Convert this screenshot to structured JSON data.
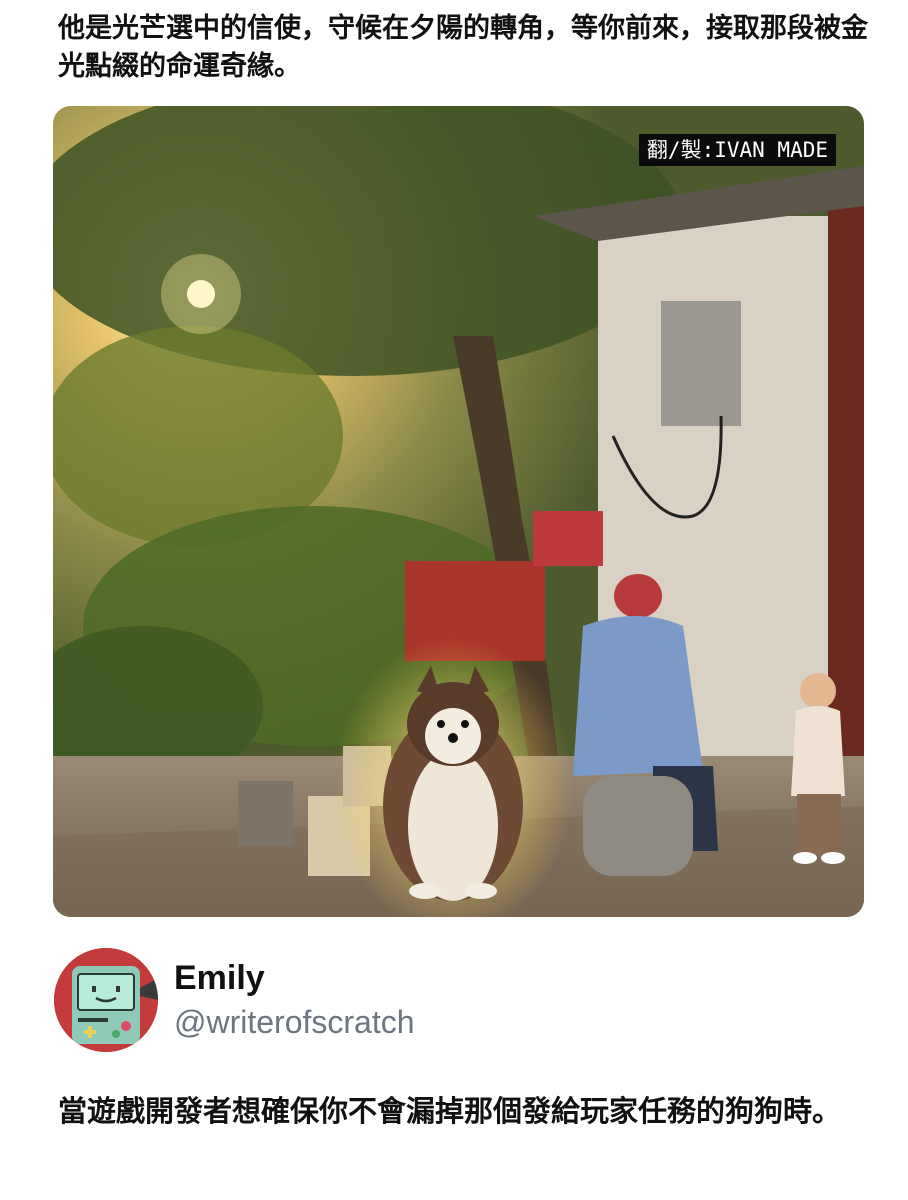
{
  "caption": "他是光芒選中的信使，守候在夕陽的轉角，等你前來，接取那段被金光點綴的命運奇緣。",
  "photo": {
    "watermark": "翻/製:IVAN MADE"
  },
  "author": {
    "display_name": "Emily",
    "handle": "@writerofscratch",
    "avatar_icon": "bmo-robot-avatar-icon"
  },
  "post_text": "當遊戲開發者想確保你不會漏掉那個發給玩家任務的狗狗時。",
  "colors": {
    "text": "#111111",
    "handle": "#6b7680",
    "watermark_bg": "#0b0b0b"
  }
}
